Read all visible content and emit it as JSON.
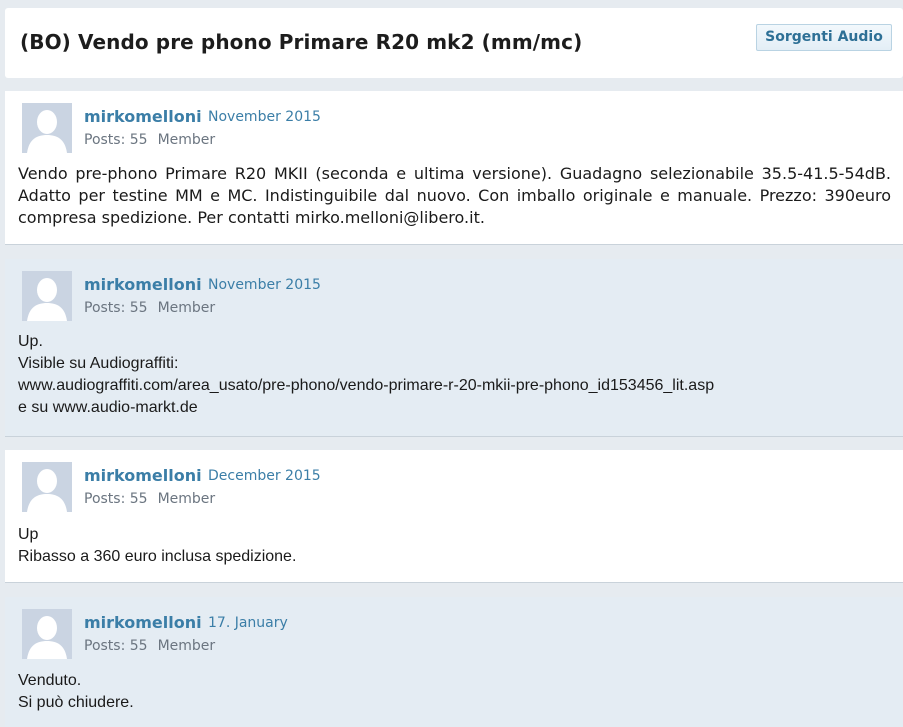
{
  "thread": {
    "title": "(BO) Vendo pre phono Primare R20 mk2 (mm/mc)",
    "category_button": "Sorgenti Audio"
  },
  "posts": [
    {
      "author": "mirkomelloni",
      "date": "November 2015",
      "posts_label": "Posts: 55",
      "role": "Member",
      "body": "Vendo pre-phono Primare R20 MKII (seconda e ultima versione). Guadagno selezionabile 35.5-41.5-54dB. Adatto per testine MM e MC. Indistinguibile dal nuovo. Con imballo originale e manuale. Prezzo: 390euro compresa spedizione. Per contatti mirko.melloni@libero.it."
    },
    {
      "author": "mirkomelloni",
      "date": "November 2015",
      "posts_label": "Posts: 55",
      "role": "Member",
      "body_lines": [
        "Up.",
        "Visible su Audiograffiti:",
        "www.audiograffiti.com/area_usato/pre-phono/vendo-primare-r-20-mkii-pre-phono_id153456_lit.asp",
        "e su www.audio-markt.de"
      ]
    },
    {
      "author": "mirkomelloni",
      "date": "December 2015",
      "posts_label": "Posts: 55",
      "role": "Member",
      "body_lines": [
        "Up",
        "Ribasso a 360 euro inclusa spedizione."
      ]
    },
    {
      "author": "mirkomelloni",
      "date": "17. January",
      "posts_label": "Posts: 55",
      "role": "Member",
      "body_lines": [
        "Venduto.",
        "Si può chiudere."
      ]
    }
  ],
  "icons": {
    "avatar": "default-user-avatar-icon"
  },
  "colors": {
    "link": "#3b7ea7",
    "post_alt_bg": "#e4ecf3",
    "avatar_bg": "#cad4e2"
  }
}
